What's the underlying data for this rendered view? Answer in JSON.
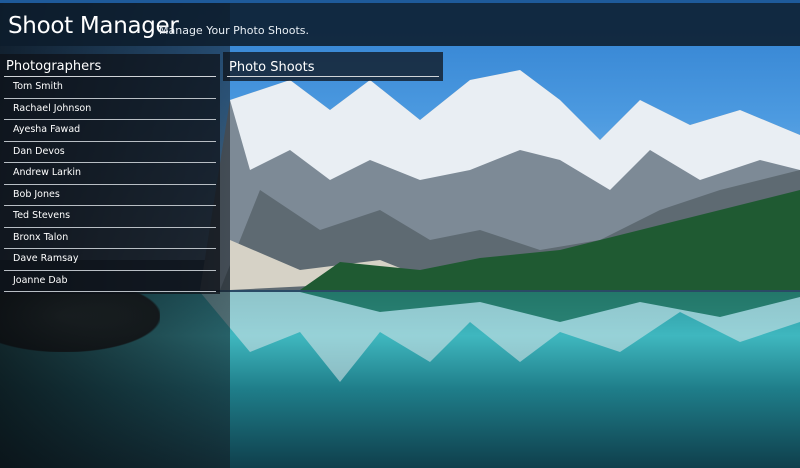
{
  "header": {
    "title": "Shoot Manager",
    "subtitle": "Manage Your Photo Shoots."
  },
  "photographers": {
    "title": "Photographers",
    "items": [
      "Tom Smith",
      "Rachael Johnson",
      "Ayesha Fawad",
      "Dan Devos",
      "Andrew Larkin",
      "Bob Jones",
      "Ted Stevens",
      "Bronx Talon",
      "Dave Ramsay",
      "Joanne Dab"
    ]
  },
  "photo_shoots": {
    "title": "Photo Shoots"
  },
  "colors": {
    "header_bg": "#0c1c2c",
    "accent": "#1e5a9a",
    "text": "#ffffff"
  }
}
